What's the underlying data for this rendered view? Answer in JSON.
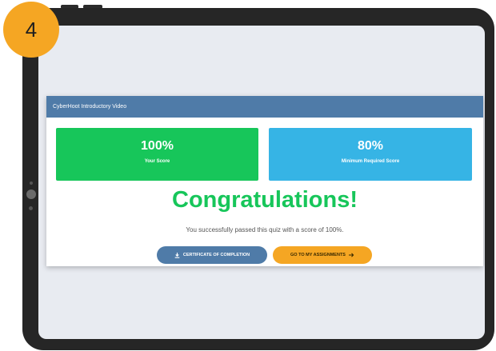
{
  "step_badge": "4",
  "card": {
    "title": "CyberHoot Introductory Video"
  },
  "scores": {
    "your_score_value": "100%",
    "your_score_label": "Your Score",
    "required_value": "80%",
    "required_label": "Minimum Required Score"
  },
  "result": {
    "headline": "Congratulations!",
    "message": "You successfully passed this quiz with a score of 100%."
  },
  "buttons": {
    "certificate_label": "CERTIFICATE OF COMPLETION",
    "certificate_icon": "download-icon",
    "assignments_label": "GO TO MY ASSIGNMENTS",
    "assignments_icon": "arrow-right-icon"
  },
  "colors": {
    "badge": "#f5a623",
    "header": "#4f7ba8",
    "success": "#17c65a",
    "info": "#36b4e5",
    "accent": "#f5a623"
  }
}
